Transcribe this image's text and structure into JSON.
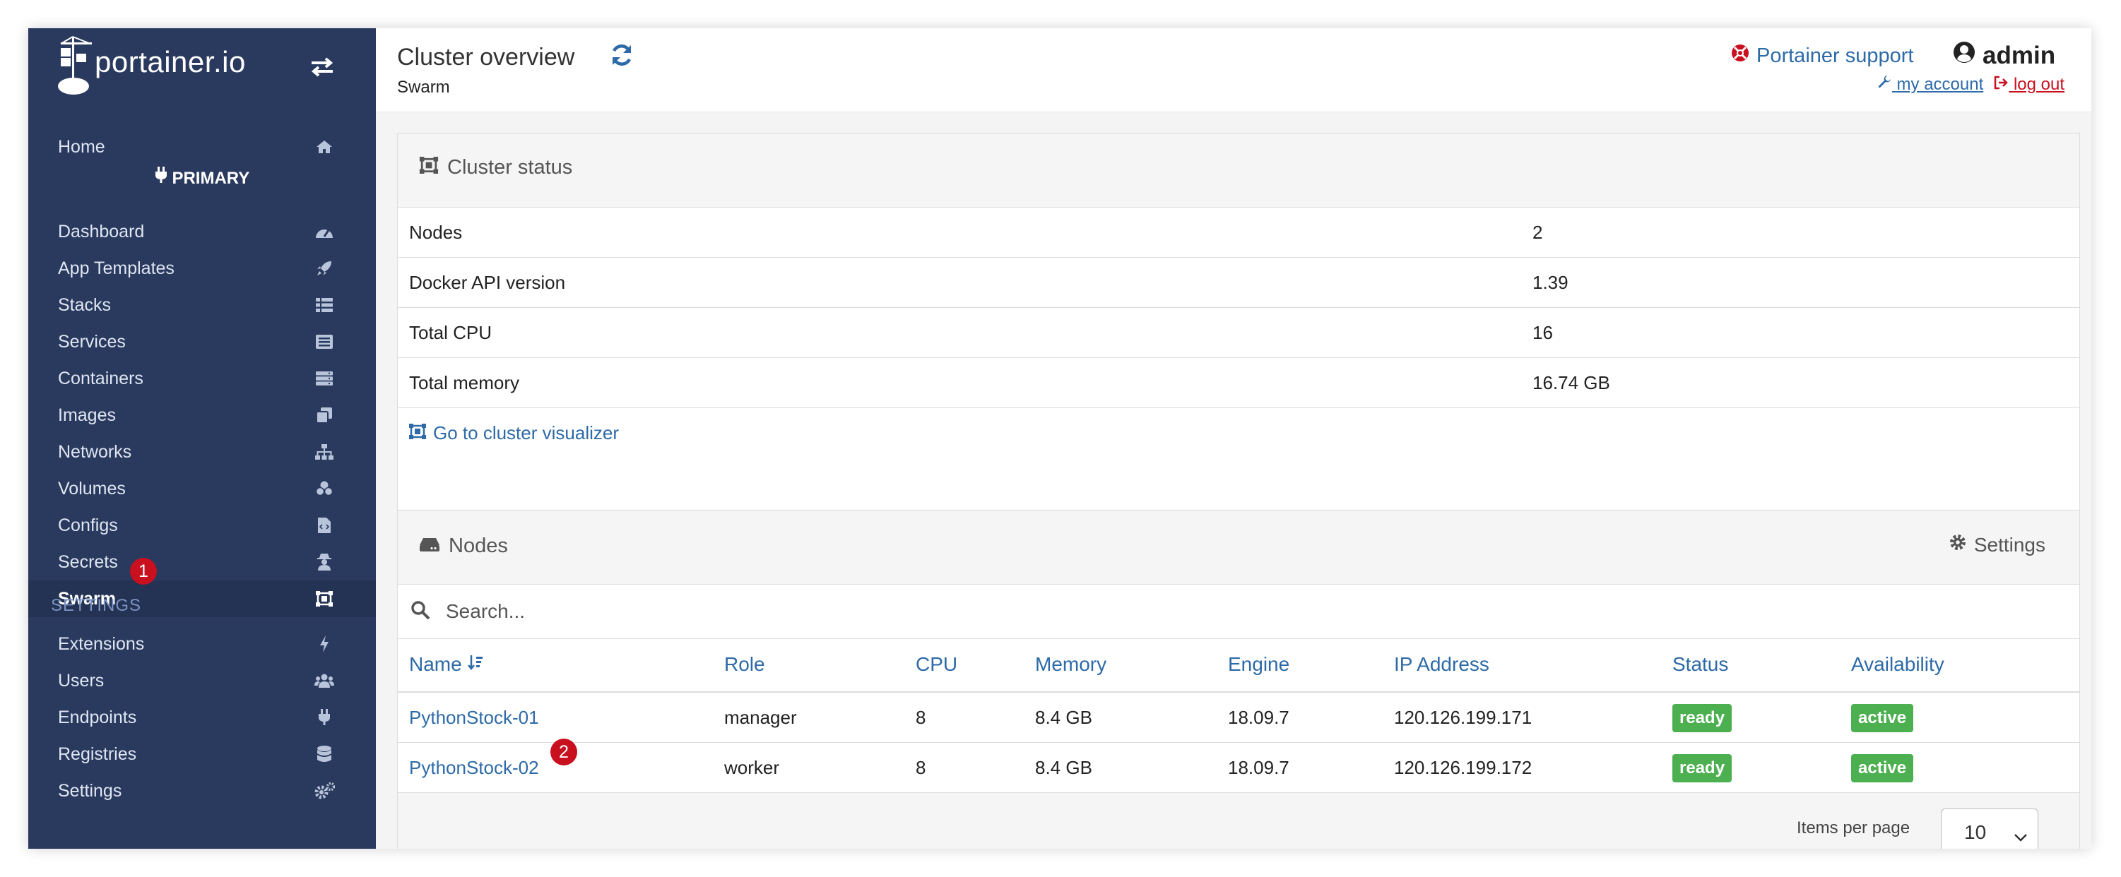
{
  "app": {
    "logo_text": "portainer.io",
    "environment": "PRIMARY"
  },
  "sidebar": {
    "home": {
      "label": "Home",
      "icon": "home-icon"
    },
    "items": [
      {
        "label": "Dashboard",
        "icon": "dashboard-icon"
      },
      {
        "label": "App Templates",
        "icon": "rocket-icon"
      },
      {
        "label": "Stacks",
        "icon": "th-list-icon"
      },
      {
        "label": "Services",
        "icon": "list-alt-icon"
      },
      {
        "label": "Containers",
        "icon": "server-icon"
      },
      {
        "label": "Images",
        "icon": "clone-icon"
      },
      {
        "label": "Networks",
        "icon": "sitemap-icon"
      },
      {
        "label": "Volumes",
        "icon": "cubes-icon"
      },
      {
        "label": "Configs",
        "icon": "file-code-icon"
      },
      {
        "label": "Secrets",
        "icon": "user-secret-icon"
      },
      {
        "label": "Swarm",
        "icon": "object-group-icon",
        "active": true
      }
    ],
    "settings_heading": "SETTINGS",
    "settings_items": [
      {
        "label": "Extensions",
        "icon": "bolt-icon"
      },
      {
        "label": "Users",
        "icon": "users-icon"
      },
      {
        "label": "Endpoints",
        "icon": "plug-icon"
      },
      {
        "label": "Registries",
        "icon": "database-icon"
      },
      {
        "label": "Settings",
        "icon": "cogs-icon"
      }
    ]
  },
  "annotations": {
    "badge1": "1",
    "badge2": "2"
  },
  "header": {
    "title": "Cluster overview",
    "breadcrumb": "Swarm",
    "support": "Portainer support",
    "user": "admin",
    "my_account": "my account",
    "log_out": "log out"
  },
  "cluster_status": {
    "title": "Cluster status",
    "rows": [
      {
        "key": "Nodes",
        "value": "2"
      },
      {
        "key": "Docker API version",
        "value": "1.39"
      },
      {
        "key": "Total CPU",
        "value": "16"
      },
      {
        "key": "Total memory",
        "value": "16.74 GB"
      }
    ],
    "visualizer_link": "Go to cluster visualizer"
  },
  "nodes": {
    "title": "Nodes",
    "settings_label": "Settings",
    "search_placeholder": "Search...",
    "columns": [
      "Name",
      "Role",
      "CPU",
      "Memory",
      "Engine",
      "IP Address",
      "Status",
      "Availability"
    ],
    "rows": [
      {
        "name": "PythonStock-01",
        "role": "manager",
        "cpu": "8",
        "memory": "8.4 GB",
        "engine": "18.09.7",
        "ip": "120.126.199.171",
        "status": "ready",
        "availability": "active"
      },
      {
        "name": "PythonStock-02",
        "role": "worker",
        "cpu": "8",
        "memory": "8.4 GB",
        "engine": "18.09.7",
        "ip": "120.126.199.172",
        "status": "ready",
        "availability": "active"
      }
    ],
    "items_per_page_label": "Items per page",
    "items_per_page": "10"
  },
  "colors": {
    "sidebar_bg": "#2a3a5f",
    "link": "#2d6aa7",
    "badge_green": "#4caf50",
    "alert_red": "#c8101e"
  }
}
